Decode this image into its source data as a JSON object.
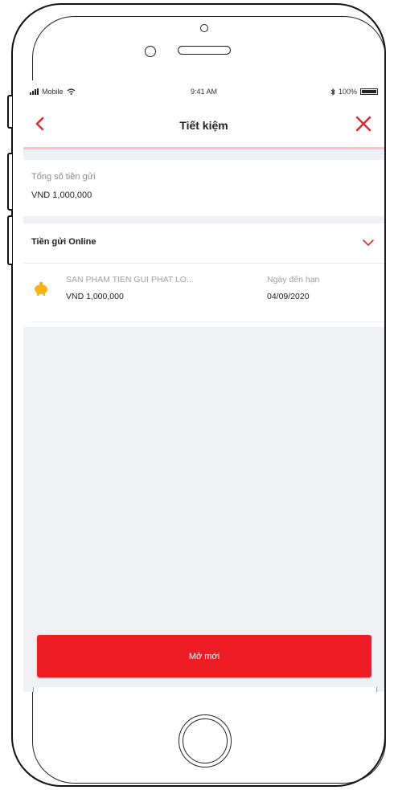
{
  "status_bar": {
    "carrier": "Mobile",
    "time": "9:41 AM",
    "battery": "100%",
    "bluetooth_icon": "bluetooth-icon"
  },
  "navbar": {
    "title": "Tiết kiệm",
    "back_icon": "chevron-left-icon",
    "close_icon": "close-icon"
  },
  "summary": {
    "label": "Tổng số tiền gửi",
    "value": "VND 1,000,000"
  },
  "online_deposits": {
    "title": "Tiền gửi Online",
    "expand_icon": "chevron-down-icon",
    "items": [
      {
        "icon": "piggy-bank-icon",
        "name": "SAN PHAM TIEN GUI PHAT LO...",
        "amount": "VND 1,000,000",
        "due_label": "Ngày đến hạn",
        "due_date": "04/09/2020"
      }
    ]
  },
  "actions": {
    "open_new_label": "Mở mới"
  },
  "colors": {
    "accent": "#ee1c25",
    "navbar_underline": "#f3c3c6",
    "background": "#eef0f3",
    "piggy_icon": "#f5b50a"
  }
}
